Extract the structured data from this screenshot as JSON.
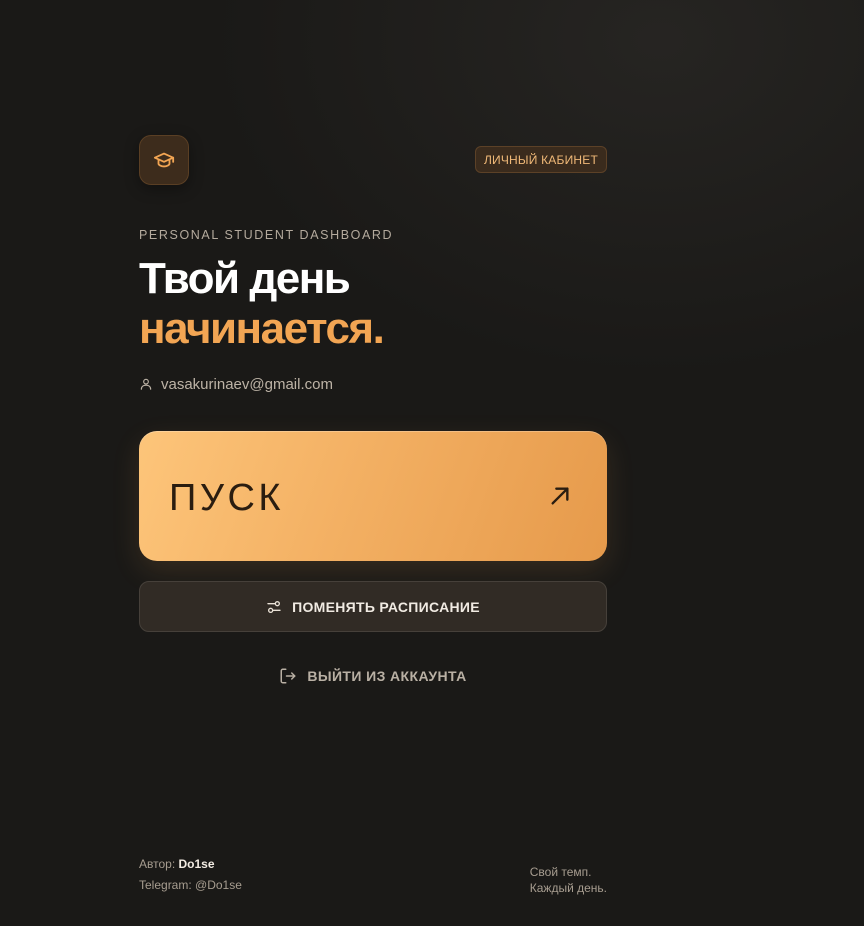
{
  "header": {
    "logo_icon": "graduation-cap-icon",
    "badge_label": "ЛИЧНЫЙ КАБИНЕТ"
  },
  "hero": {
    "eyebrow": "PERSONAL STUDENT DASHBOARD",
    "title_line1": "Твой день",
    "title_line2": "начинается.",
    "user_icon": "user-icon",
    "email": "vasakurinaev@gmail.com"
  },
  "actions": {
    "start_label": "ПУСК",
    "start_icon": "arrow-up-right-icon",
    "schedule_label": "ПОМЕНЯТЬ РАСПИСАНИЕ",
    "schedule_icon": "sliders-icon",
    "logout_label": "ВЫЙТИ ИЗ АККАУНТА",
    "logout_icon": "log-out-icon"
  },
  "footer": {
    "author_prefix": "Автор:",
    "author_name": "Do1se",
    "telegram": "Telegram: @Do1se",
    "tagline_line1": "Свой темп.",
    "tagline_line2": "Каждый день."
  },
  "colors": {
    "background": "#1a1917",
    "accent": "#f2a553",
    "start_gradient_from": "#fdc57a",
    "start_gradient_to": "#e69a4b",
    "secondary_button": "#312b25"
  }
}
